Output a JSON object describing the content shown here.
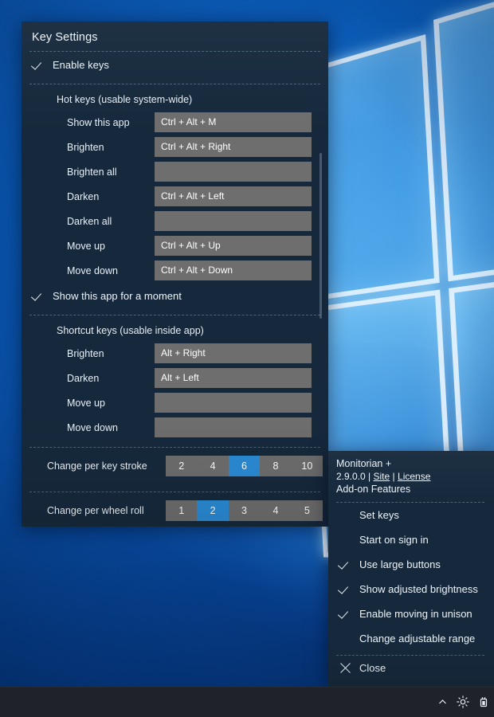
{
  "key_settings": {
    "title": "Key Settings",
    "enable_keys": {
      "label": "Enable keys",
      "checked": true
    },
    "hot_keys": {
      "section_label": "Hot keys (usable system-wide)",
      "rows": [
        {
          "label": "Show this app",
          "value": "Ctrl + Alt + M"
        },
        {
          "label": "Brighten",
          "value": "Ctrl + Alt + Right"
        },
        {
          "label": "Brighten all",
          "value": ""
        },
        {
          "label": "Darken",
          "value": "Ctrl + Alt + Left"
        },
        {
          "label": "Darken all",
          "value": ""
        },
        {
          "label": "Move up",
          "value": "Ctrl + Alt + Up"
        },
        {
          "label": "Move down",
          "value": "Ctrl + Alt + Down"
        }
      ]
    },
    "show_moment": {
      "label": "Show this app for a moment",
      "checked": true
    },
    "shortcut_keys": {
      "section_label": "Shortcut keys (usable inside app)",
      "rows": [
        {
          "label": "Brighten",
          "value": "Alt + Right"
        },
        {
          "label": "Darken",
          "value": "Alt + Left"
        },
        {
          "label": "Move up",
          "value": ""
        },
        {
          "label": "Move down",
          "value": ""
        }
      ]
    },
    "key_stroke": {
      "label": "Change per key stroke",
      "options": [
        "2",
        "4",
        "6",
        "8",
        "10"
      ],
      "selected": "6"
    },
    "wheel_roll": {
      "label": "Change per wheel roll",
      "options": [
        "1",
        "2",
        "3",
        "4",
        "5"
      ],
      "selected": "2"
    }
  },
  "menu": {
    "app_name": "Monitorian +",
    "version": "2.9.0.0",
    "separator": "|",
    "site_link": "Site",
    "license_link": "License",
    "subtitle": "Add-on Features",
    "items": [
      {
        "label": "Set keys",
        "checked": false
      },
      {
        "label": "Start on sign in",
        "checked": false
      },
      {
        "label": "Use large buttons",
        "checked": true
      },
      {
        "label": "Show adjusted brightness",
        "checked": true
      },
      {
        "label": "Enable moving in unison",
        "checked": true
      },
      {
        "label": "Change adjustable range",
        "checked": false
      }
    ],
    "close_label": "Close"
  },
  "taskbar": {
    "icons": [
      "chevron-up-icon",
      "brightness-icon",
      "battery-plug-icon"
    ]
  },
  "colors": {
    "panel_background": "#16293c",
    "field_background": "#6e6e6e",
    "accent": "#2b8cd6",
    "text": "#eef4f8",
    "taskbar": "#1f2329"
  }
}
